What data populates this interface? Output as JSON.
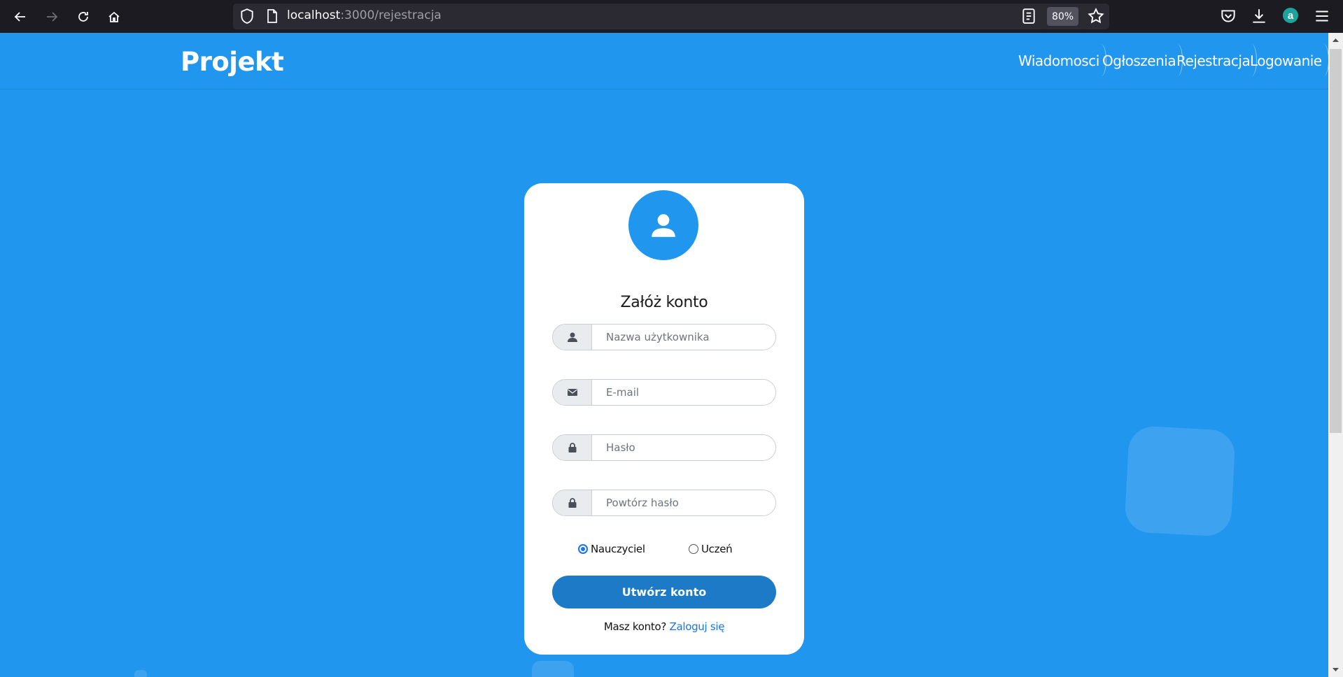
{
  "browser": {
    "url_host": "localhost",
    "url_rest": ":3000/rejestracja",
    "zoom": "80%",
    "extension_letter": "a"
  },
  "header": {
    "logo": "Projekt",
    "nav": [
      "Wiadomosci",
      "Ogłoszenia",
      "Rejestracja",
      "Logowanie"
    ]
  },
  "form": {
    "title": "Załóż konto",
    "username_placeholder": "Nazwa użytkownika",
    "email_placeholder": "E-mail",
    "password_placeholder": "Hasło",
    "repeat_password_placeholder": "Powtórz hasło",
    "roles": [
      {
        "label": "Nauczyciel",
        "selected": true
      },
      {
        "label": "Uczeń",
        "selected": false
      }
    ],
    "submit_label": "Utwórz konto",
    "login_prompt": "Masz konto?",
    "login_link": "Zaloguj się"
  },
  "colors": {
    "page_bg": "#2196ee",
    "button": "#1d7ac6",
    "link": "#1a73e8"
  }
}
